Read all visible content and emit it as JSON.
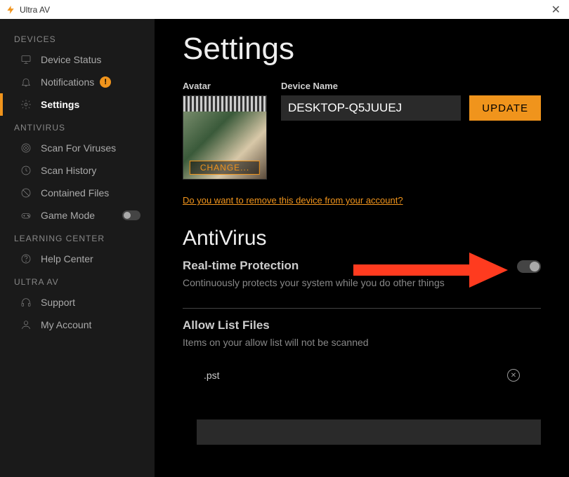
{
  "window": {
    "title": "Ultra AV"
  },
  "sidebar": {
    "sections": [
      {
        "label": "DEVICES",
        "items": [
          {
            "label": "Device Status",
            "icon": "monitor"
          },
          {
            "label": "Notifications",
            "icon": "bell",
            "badge": "!"
          },
          {
            "label": "Settings",
            "icon": "gear",
            "active": true
          }
        ]
      },
      {
        "label": "ANTIVIRUS",
        "items": [
          {
            "label": "Scan For Viruses",
            "icon": "target"
          },
          {
            "label": "Scan History",
            "icon": "history"
          },
          {
            "label": "Contained Files",
            "icon": "block"
          },
          {
            "label": "Game Mode",
            "icon": "gamepad",
            "toggle": true
          }
        ]
      },
      {
        "label": "LEARNING CENTER",
        "items": [
          {
            "label": "Help Center",
            "icon": "help"
          }
        ]
      },
      {
        "label": "ULTRA AV",
        "items": [
          {
            "label": "Support",
            "icon": "headset"
          },
          {
            "label": "My Account",
            "icon": "user"
          }
        ]
      }
    ]
  },
  "settings": {
    "title": "Settings",
    "avatar_label": "Avatar",
    "change_label": "CHANGE...",
    "device_name_label": "Device Name",
    "device_name_value": "DESKTOP-Q5JUUEJ",
    "update_label": "UPDATE",
    "remove_link": "Do you want to remove this device from your account?"
  },
  "antivirus": {
    "heading": "AntiVirus",
    "realtime": {
      "title": "Real-time Protection",
      "desc": "Continuously protects your system while you do other things"
    },
    "allowlist": {
      "title": "Allow List Files",
      "desc": "Items on your allow list will not be scanned",
      "items": [
        ".pst"
      ]
    }
  }
}
